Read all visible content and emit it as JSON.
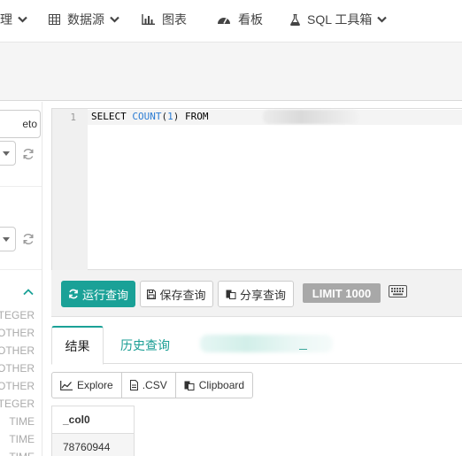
{
  "nav": {
    "items": [
      {
        "label": "理",
        "icon": "chevron-down-icon"
      },
      {
        "label": "数据源",
        "icon": "table-grid-icon"
      },
      {
        "label": "图表",
        "icon": "bar-chart-icon"
      },
      {
        "label": "看板",
        "icon": "dashboard-gauge-icon"
      },
      {
        "label": "SQL 工具箱",
        "icon": "flask-icon"
      }
    ]
  },
  "sidebar": {
    "input_value": "eto",
    "types": [
      "TEGER",
      "OTHER",
      "OTHER",
      "OTHER",
      "OTHER",
      "TEGER",
      "TIME",
      "TIME",
      "TIME"
    ]
  },
  "editor": {
    "line_number": "1",
    "code_kw1": "SELECT ",
    "code_fn": "COUNT",
    "code_paren_open": "(",
    "code_num": "1",
    "code_paren_close": ")",
    "code_kw2": " FROM"
  },
  "toolbar": {
    "run_label": "运行查询",
    "save_label": "保存查询",
    "share_label": "分享查询",
    "limit_label": "LIMIT 1000"
  },
  "tabs": {
    "results_label": "结果",
    "history_label": "历史查询"
  },
  "exports": {
    "explore_label": "Explore",
    "csv_label": ".CSV",
    "clipboard_label": "Clipboard"
  },
  "results": {
    "column": "_col0",
    "rows": [
      "78760944"
    ]
  },
  "colors": {
    "accent": "#1aa197",
    "limit_badge": "#a8a8a8"
  }
}
